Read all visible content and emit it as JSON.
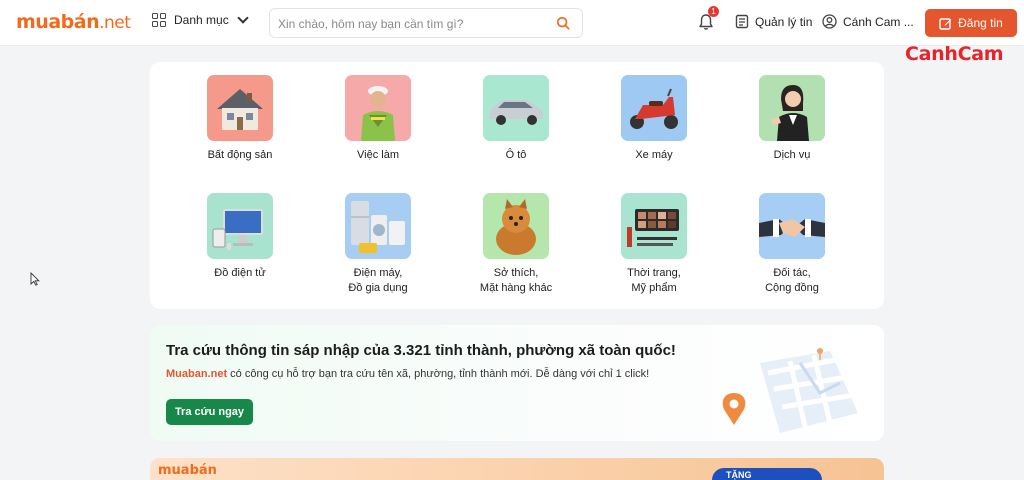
{
  "header": {
    "logo": {
      "main": "muabán",
      "suffix": ".net"
    },
    "category_menu_label": "Danh mục",
    "search_placeholder": "Xin chào, hôm nay bạn cần tìm gì?",
    "notification_count": "1",
    "manage_label": "Quản lý tin",
    "user_name": "Cánh Cam ...",
    "post_button_label": "Đăng tin"
  },
  "watermark": "CanhCam",
  "categories": [
    {
      "label": "Bất động sản",
      "icon": "house-icon",
      "bg": "#f59a8a"
    },
    {
      "label": "Việc làm",
      "icon": "worker-icon",
      "bg": "#f6a9a9"
    },
    {
      "label": "Ô tô",
      "icon": "car-icon",
      "bg": "#a9e7d0"
    },
    {
      "label": "Xe máy",
      "icon": "scooter-icon",
      "bg": "#9ec9f3"
    },
    {
      "label": "Dịch vụ",
      "icon": "service-person-icon",
      "bg": "#b2e0b0"
    },
    {
      "label": "Đồ điện tử",
      "icon": "computer-icon",
      "bg": "#a7e3cf"
    },
    {
      "label": "Điện máy,",
      "label2": "Đồ gia dụng",
      "icon": "appliances-icon",
      "bg": "#a8cdf2"
    },
    {
      "label": "Sở thích,",
      "label2": "Mặt hàng khác",
      "icon": "dog-icon",
      "bg": "#b5e7ad"
    },
    {
      "label": "Thời trang,",
      "label2": "Mỹ phẩm",
      "icon": "cosmetics-icon",
      "bg": "#a9e4d0"
    },
    {
      "label": "Đối tác,",
      "label2": "Cộng đồng",
      "icon": "handshake-icon",
      "bg": "#a6cdf3"
    }
  ],
  "lookup": {
    "title": "Tra cứu thông tin sáp nhập của 3.321 tỉnh thành, phường xã toàn quốc!",
    "desc_brand": "Muaban.net",
    "desc_text": " có công cụ hỗ trợ bạn tra cứu tên xã, phường, tỉnh thành mới. Dễ dàng với chỉ 1 click!",
    "button_label": "Tra cứu ngay"
  },
  "promo": {
    "logo": "muabán",
    "tag": "TẶNG"
  },
  "colors": {
    "brand_orange": "#f26b1d",
    "post_button": "#e4572e",
    "lookup_button": "#17884a",
    "watermark": "#e8242b"
  }
}
